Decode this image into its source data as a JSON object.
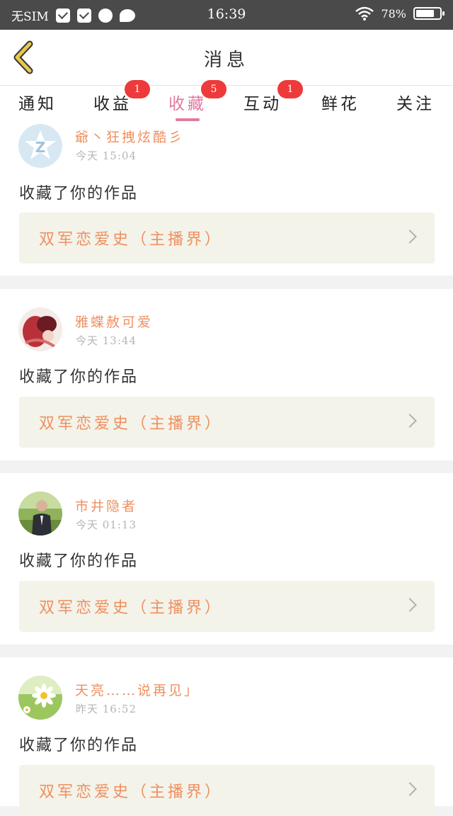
{
  "status_bar": {
    "carrier": "无SIM",
    "time": "16:39",
    "battery": "78%",
    "battery_level": 0.78,
    "icons": [
      "mail-icon",
      "mail-icon",
      "browser-icon",
      "chat-icon",
      "wifi-icon",
      "battery-icon"
    ]
  },
  "header": {
    "title": "消息",
    "back_icon": "chevron-left-icon",
    "accent": "#e8c84a"
  },
  "tabs": [
    {
      "label": "通知",
      "badge": ""
    },
    {
      "label": "收益",
      "badge": "1"
    },
    {
      "label": "收藏",
      "badge": "5",
      "active": true
    },
    {
      "label": "互动",
      "badge": "1"
    },
    {
      "label": "鲜花",
      "badge": ""
    },
    {
      "label": "关注",
      "badge": ""
    }
  ],
  "colors": {
    "active_tab": "#e07aa1",
    "badge": "#ee3a3a",
    "username": "#ef9060",
    "work_title": "#ef9060",
    "work_box": "#f3f3ea"
  },
  "feed": [
    {
      "username": "爺丶狂拽炫酷彡",
      "time": "今天 15:04",
      "action": "收藏了你的作品",
      "work": "双军恋爱史（主播界）"
    },
    {
      "username": "雅蝶赦可爱",
      "time": "今天 13:44",
      "action": "收藏了你的作品",
      "work": "双军恋爱史（主播界）"
    },
    {
      "username": "市井隐者",
      "time": "今天 01:13",
      "action": "收藏了你的作品",
      "work": "双军恋爱史（主播界）"
    },
    {
      "username": "天亮……说再见」",
      "time": "昨天 16:52",
      "action": "收藏了你的作品",
      "work": "双军恋爱史（主播界）"
    }
  ]
}
